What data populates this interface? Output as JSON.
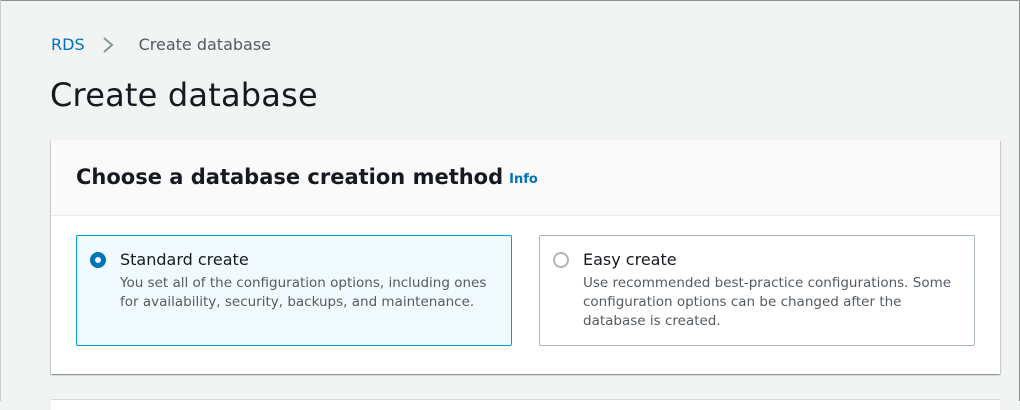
{
  "breadcrumb": {
    "root": "RDS",
    "current": "Create database"
  },
  "page": {
    "title": "Create database"
  },
  "creation_method": {
    "heading": "Choose a database creation method",
    "info_label": "Info",
    "options": [
      {
        "title": "Standard create",
        "description": "You set all of the configuration options, including ones for availability, security, backups, and maintenance.",
        "selected": true
      },
      {
        "title": "Easy create",
        "description": "Use recommended best-practice configurations. Some configuration options can be changed after the database is created.",
        "selected": false
      }
    ]
  },
  "colors": {
    "link": "#0073bb",
    "selected_border": "#00a1c9",
    "selected_background": "#f1faff",
    "page_background": "#f2f3f3"
  }
}
